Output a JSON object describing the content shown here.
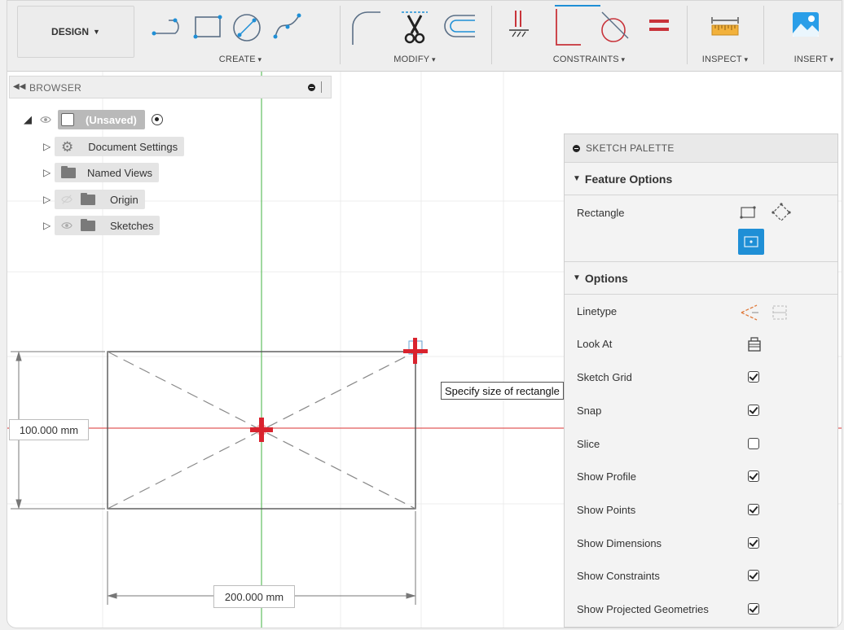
{
  "toolbar": {
    "design_label": "DESIGN",
    "groups": {
      "create": "CREATE",
      "modify": "MODIFY",
      "constraints": "CONSTRAINTS",
      "inspect": "INSPECT",
      "insert": "INSERT"
    },
    "accent_color": "#1f8fd6"
  },
  "browser": {
    "title": "BROWSER",
    "root": "(Unsaved)",
    "items": [
      {
        "label": "Document Settings",
        "icon": "gear-icon"
      },
      {
        "label": "Named Views",
        "icon": "folder-icon"
      },
      {
        "label": "Origin",
        "icon": "folder-icon"
      },
      {
        "label": "Sketches",
        "icon": "folder-icon"
      }
    ]
  },
  "canvas": {
    "dim_height": "100.000 mm",
    "dim_width": "200.000 mm",
    "tooltip": "Specify size of rectangle",
    "axis_red": "#e25b5b",
    "axis_green": "#6cc46c",
    "cursor_red": "#d9232e"
  },
  "palette": {
    "title": "SKETCH PALETTE",
    "feature_options": "Feature Options",
    "rectangle_label": "Rectangle",
    "options": "Options",
    "rows": [
      {
        "label": "Linetype",
        "kind": "icons"
      },
      {
        "label": "Look At",
        "kind": "icon"
      },
      {
        "label": "Sketch Grid",
        "checked": true
      },
      {
        "label": "Snap",
        "checked": true
      },
      {
        "label": "Slice",
        "checked": false
      },
      {
        "label": "Show Profile",
        "checked": true
      },
      {
        "label": "Show Points",
        "checked": true
      },
      {
        "label": "Show Dimensions",
        "checked": true
      },
      {
        "label": "Show Constraints",
        "checked": true
      },
      {
        "label": "Show Projected Geometries",
        "checked": true
      }
    ]
  }
}
